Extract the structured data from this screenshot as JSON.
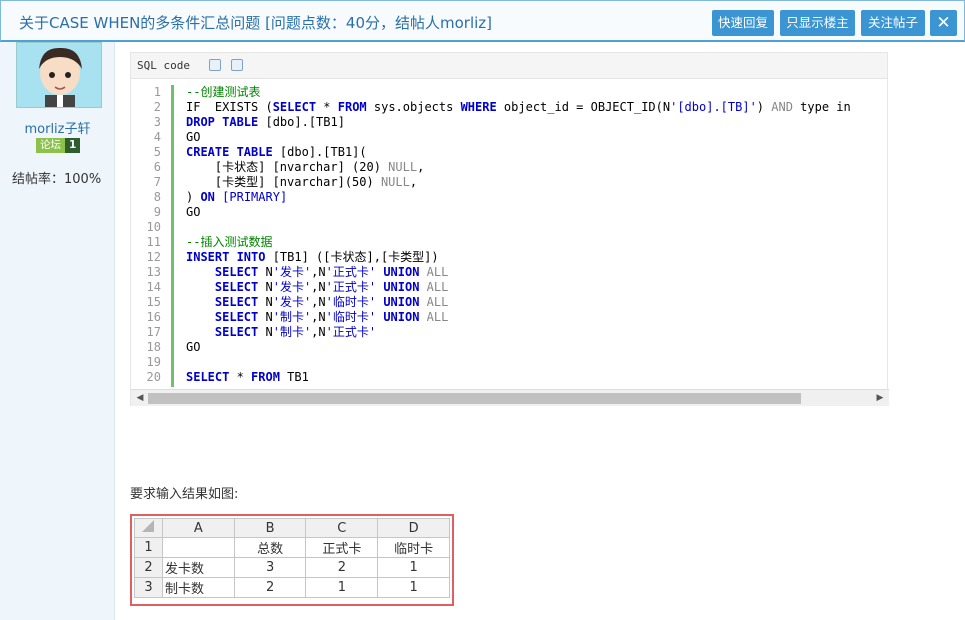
{
  "header": {
    "title": "关于CASE WHEN的多条件汇总问题 [问题点数：40分，结帖人morliz]",
    "reply_label": "快速回复",
    "owner_only_label": "只显示楼主",
    "follow_label": "关注帖子",
    "close_label": "✕"
  },
  "user": {
    "name": "morliz子轩",
    "badge_text": "论坛",
    "badge_level": "1",
    "close_rate": "结帖率：100%"
  },
  "code": {
    "header_label": "SQL code",
    "line_numbers": [
      "1",
      "2",
      "3",
      "4",
      "5",
      "6",
      "7",
      "8",
      "9",
      "10",
      "11",
      "12",
      "13",
      "14",
      "15",
      "16",
      "17",
      "18",
      "19",
      "20"
    ]
  },
  "content": {
    "requirement": "要求输入结果如图:"
  },
  "excel": {
    "col_headers": [
      "A",
      "B",
      "C",
      "D"
    ],
    "rows": [
      {
        "num": "1",
        "cells": [
          "",
          "总数",
          "正式卡",
          "临时卡"
        ]
      },
      {
        "num": "2",
        "cells": [
          "发卡数",
          "3",
          "2",
          "1"
        ]
      },
      {
        "num": "3",
        "cells": [
          "制卡数",
          "2",
          "1",
          "1"
        ]
      }
    ]
  }
}
